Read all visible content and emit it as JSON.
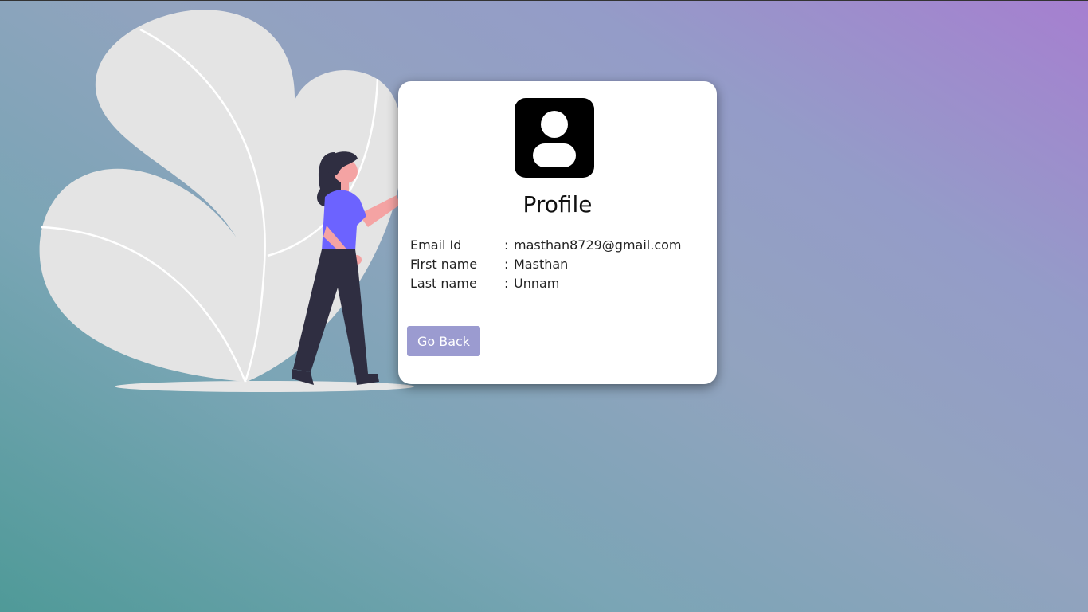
{
  "profile": {
    "title": "Profile",
    "fields": [
      {
        "label": "Email Id",
        "separator": ":",
        "value": "masthan8729@gmail.com"
      },
      {
        "label": "First name",
        "separator": ":",
        "value": "Masthan"
      },
      {
        "label": "Last name",
        "separator": ":",
        "value": "Unnam"
      }
    ],
    "back_button_label": "Go Back"
  },
  "icons": {
    "avatar": "user-avatar-icon"
  },
  "colors": {
    "button": "#9b9bd0",
    "card": "#ffffff",
    "shirt": "#6c63ff"
  }
}
